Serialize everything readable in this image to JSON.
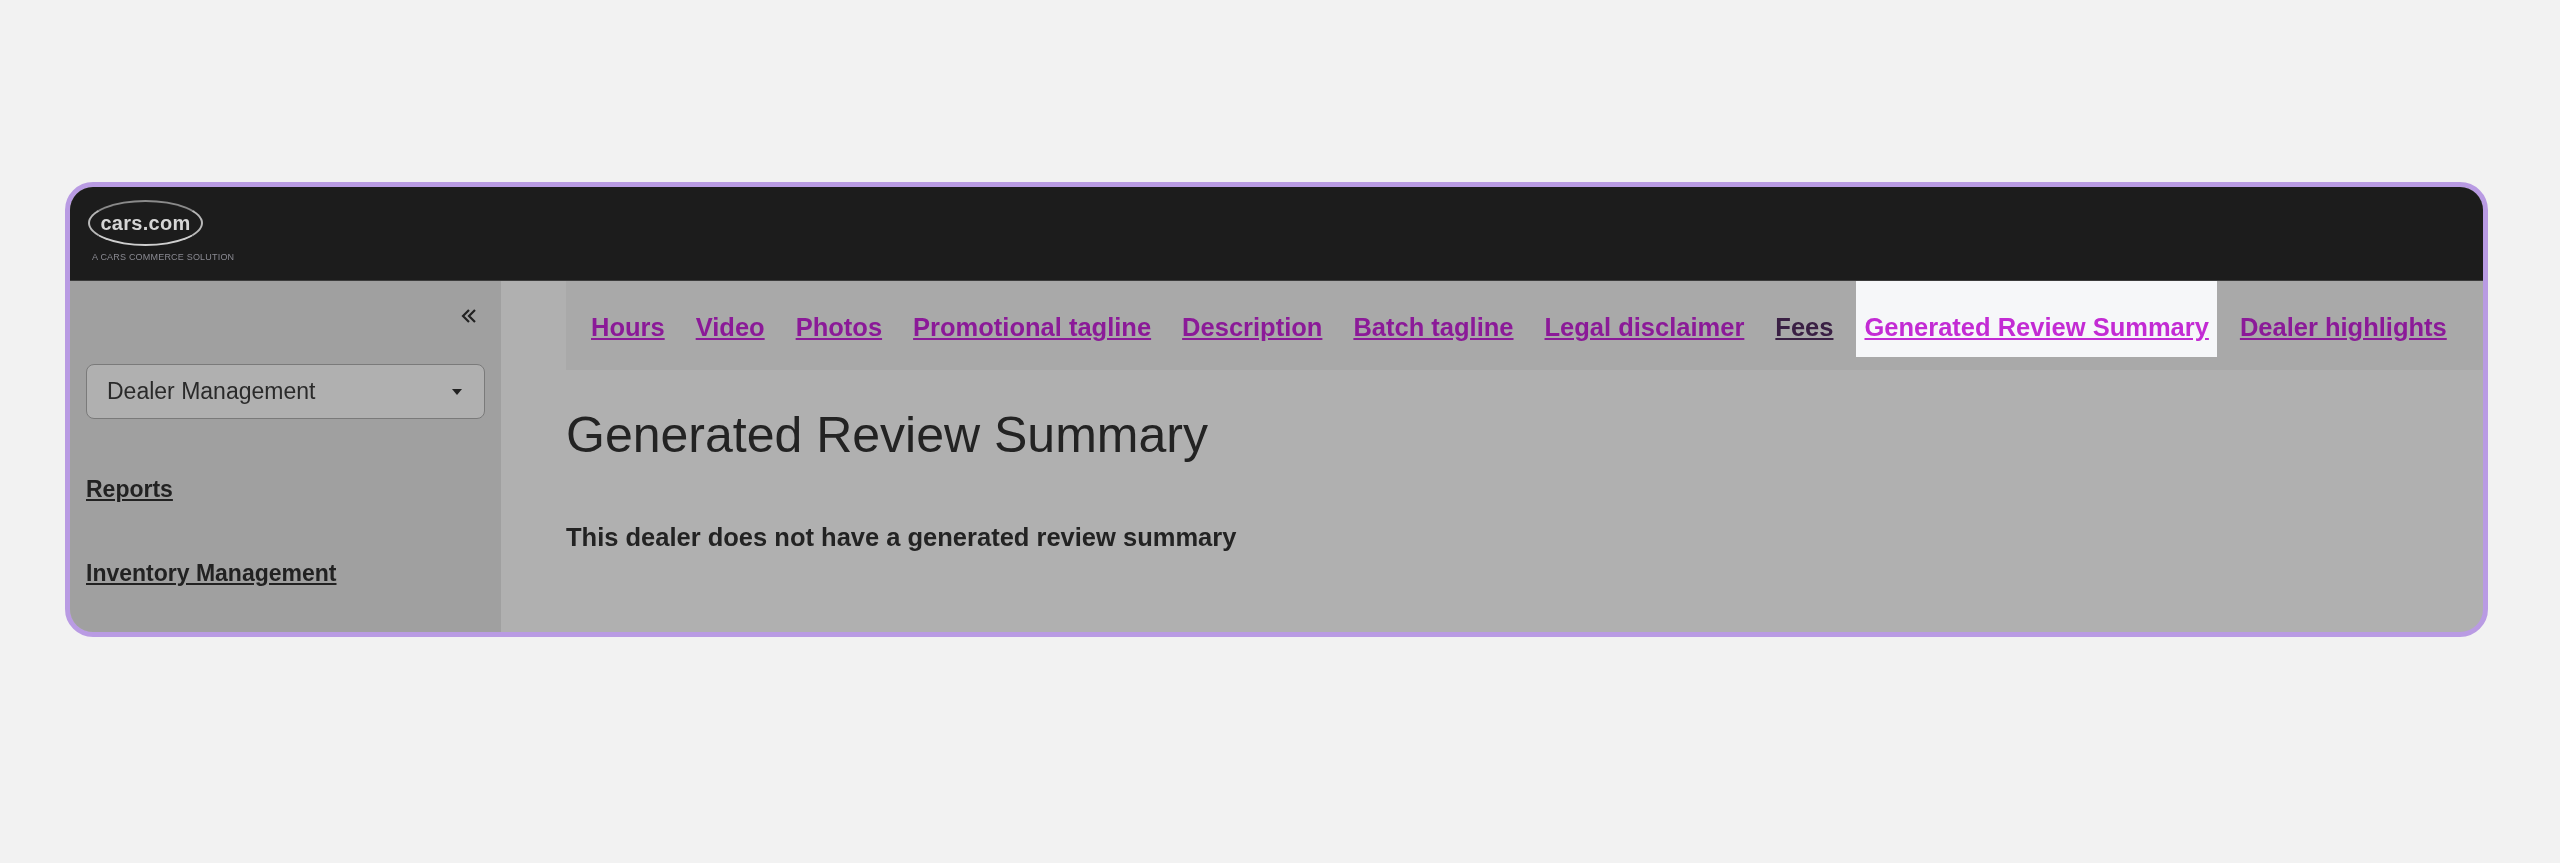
{
  "header": {
    "logo_text": "cars.com",
    "tagline": "A CARS COMMERCE SOLUTION"
  },
  "sidebar": {
    "dropdown": {
      "value": "Dealer Management"
    },
    "links": [
      "Reports",
      "Inventory Management"
    ]
  },
  "tabs": [
    {
      "label": "Hours",
      "selected": false,
      "visited": false
    },
    {
      "label": "Video",
      "selected": false,
      "visited": false
    },
    {
      "label": "Photos",
      "selected": false,
      "visited": false
    },
    {
      "label": "Promotional tagline",
      "selected": false,
      "visited": false
    },
    {
      "label": "Description",
      "selected": false,
      "visited": false
    },
    {
      "label": "Batch tagline",
      "selected": false,
      "visited": false
    },
    {
      "label": "Legal disclaimer",
      "selected": false,
      "visited": false
    },
    {
      "label": "Fees",
      "selected": false,
      "visited": true
    },
    {
      "label": "Generated Review Summary",
      "selected": true,
      "visited": false
    },
    {
      "label": "Dealer highlights",
      "selected": false,
      "visited": false
    }
  ],
  "content": {
    "heading": "Generated Review Summary",
    "message": "This dealer does not have a generated review summary"
  }
}
